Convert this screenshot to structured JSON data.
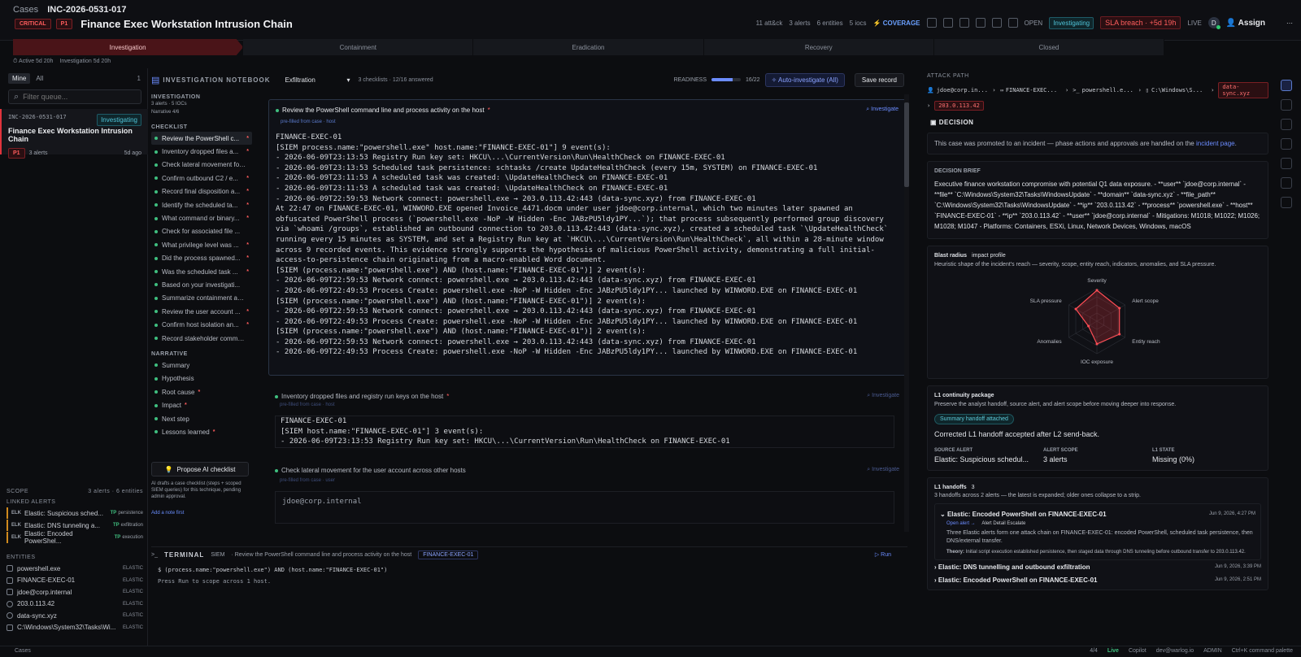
{
  "header": {
    "crumb_root": "Cases",
    "case_id": "INC-2026-0531-017",
    "severity_label": "CRITICAL",
    "priority": "P1",
    "title": "Finance Exec Workstation Intrusion Chain",
    "meta_attck": "11 att&ck",
    "meta_alerts": "3 alerts",
    "meta_entities": "6 entities",
    "meta_iocs": "5 iocs",
    "coverage_label": "COVERAGE",
    "open_label": "OPEN",
    "status": "Investigating",
    "sla": "SLA breach · +5d 19h",
    "live_label": "LIVE",
    "avatar_initial": "D",
    "assign_label": "Assign"
  },
  "phases": [
    "Investigation",
    "Containment",
    "Eradication",
    "Recovery",
    "Closed"
  ],
  "substatus": {
    "active": "Active 5d 20h",
    "investigation": "Investigation 5d 20h"
  },
  "queue": {
    "tab_mine": "Mine",
    "tab_all": "All",
    "count": "1",
    "filter_placeholder": "Filter queue...",
    "card": {
      "id": "INC-2026-0531-017",
      "status": "Investigating",
      "title": "Finance Exec Workstation Intrusion Chain",
      "priority": "P1",
      "alerts": "3 alerts",
      "ago": "5d ago"
    }
  },
  "scope": {
    "label": "SCOPE",
    "summary": "3 alerts · 6 entities",
    "linked_label": "LINKED ALERTS",
    "alerts": [
      {
        "src": "ELK",
        "name": "Elastic: Suspicious sched...",
        "tp": "TP",
        "tactic": "persistence"
      },
      {
        "src": "ELK",
        "name": "Elastic: DNS tunneling a...",
        "tp": "TP",
        "tactic": "exfiltration"
      },
      {
        "src": "ELK",
        "name": "Elastic: Encoded PowerShel...",
        "tp": "TP",
        "tactic": "execution"
      }
    ],
    "entities_label": "ENTITIES",
    "entities": [
      {
        "name": "powershell.exe",
        "src": "ELASTIC"
      },
      {
        "name": "FINANCE-EXEC-01",
        "src": "ELASTIC"
      },
      {
        "name": "jdoe@corp.internal",
        "src": "ELASTIC"
      },
      {
        "name": "203.0.113.42",
        "src": "ELASTIC"
      },
      {
        "name": "data-sync.xyz",
        "src": "ELASTIC"
      },
      {
        "name": "C:\\Windows\\System32\\Tasks\\Wi...",
        "src": "ELASTIC"
      }
    ]
  },
  "notebook": {
    "title": "INVESTIGATION NOTEBOOK",
    "technique": "Exfiltration",
    "sub": "3 checklists · 12/16 answered",
    "readiness_label": "READINESS",
    "readiness_value": "16/22",
    "readiness_fraction": 0.727,
    "auto_label": "Auto-investigate (All)",
    "save_label": "Save record",
    "inv_label": "INVESTIGATION",
    "inv_line1": "3 alerts · 5 IOCs",
    "inv_line2": "Narrative 4/6",
    "checklist_label": "CHECKLIST",
    "checklist": [
      "Review the PowerShell c...",
      "Inventory dropped files a...",
      "Check lateral movement for...",
      "Confirm outbound C2 / e...",
      "Record final disposition a...",
      "Identify the scheduled ta...",
      "What command or binary...",
      "Check for associated file ...",
      "What privilege level was ...",
      "Did the process spawned...",
      "Was the scheduled task ...",
      "Based on your investigati...",
      "Summarize containment an...",
      "Review the user account ...",
      "Confirm host isolation an...",
      "Record stakeholder commu..."
    ],
    "checklist_required": [
      true,
      true,
      false,
      true,
      true,
      true,
      true,
      false,
      true,
      true,
      true,
      false,
      false,
      true,
      true,
      false
    ],
    "narrative_label": "NARRATIVE",
    "narrative": [
      "Summary",
      "Hypothesis",
      "Root cause",
      "Impact",
      "Next step",
      "Lessons learned"
    ],
    "narrative_required": [
      false,
      false,
      true,
      true,
      false,
      true
    ],
    "propose_label": "Propose AI checklist",
    "propose_desc": "AI drafts a case checklist (steps + scoped SIEM queries) for this technique, pending admin approval.",
    "add_note": "Add a note first"
  },
  "tasks": [
    {
      "question": "Review the PowerShell command line and process activity on the host",
      "investigate": "Investigate",
      "prefill": "pre-filled from case · host",
      "body": "FINANCE-EXEC-01\n[SIEM process.name:\"powershell.exe\" host.name:\"FINANCE-EXEC-01\"] 9 event(s):\n- 2026-06-09T23:13:53 Registry Run key set: HKCU\\...\\CurrentVersion\\Run\\HealthCheck on FINANCE-EXEC-01\n- 2026-06-09T23:13:53 Scheduled task persistence: schtasks /create UpdateHealthCheck (every 15m, SYSTEM) on FINANCE-EXEC-01\n- 2026-06-09T23:11:53 A scheduled task was created: \\UpdateHealthCheck on FINANCE-EXEC-01\n- 2026-06-09T23:11:53 A scheduled task was created: \\UpdateHealthCheck on FINANCE-EXEC-01\n- 2026-06-09T22:59:53 Network connect: powershell.exe → 203.0.113.42:443 (data-sync.xyz) from FINANCE-EXEC-01\nAt 22:47 on FINANCE-EXEC-01, WINWORD.EXE opened Invoice_4471.docm under user jdoe@corp.internal, which two minutes later spawned an\nobfuscated PowerShell process (`powershell.exe -NoP -W Hidden -Enc JABzPU5ldy1PY...`); that process subsequently performed group discovery\nvia `whoami /groups`, established an outbound connection to 203.0.113.42:443 (data-sync.xyz), created a scheduled task `\\UpdateHealthCheck`\nrunning every 15 minutes as SYSTEM, and set a Registry Run key at `HKCU\\...\\CurrentVersion\\Run\\HealthCheck`, all within a 28-minute window\nacross 9 recorded events. This evidence strongly supports the hypothesis of malicious PowerShell activity, demonstrating a full initial-\naccess-to-persistence chain originating from a macro-enabled Word document.\n[SIEM (process.name:\"powershell.exe\") AND (host.name:\"FINANCE-EXEC-01\")] 2 event(s):\n- 2026-06-09T22:59:53 Network connect: powershell.exe → 203.0.113.42:443 (data-sync.xyz) from FINANCE-EXEC-01\n- 2026-06-09T22:49:53 Process Create: powershell.exe -NoP -W Hidden -Enc JABzPU5ldy1PY... launched by WINWORD.EXE on FINANCE-EXEC-01\n[SIEM (process.name:\"powershell.exe\") AND (host.name:\"FINANCE-EXEC-01\")] 2 event(s):\n- 2026-06-09T22:59:53 Network connect: powershell.exe → 203.0.113.42:443 (data-sync.xyz) from FINANCE-EXEC-01\n- 2026-06-09T22:49:53 Process Create: powershell.exe -NoP -W Hidden -Enc JABzPU5ldy1PY... launched by WINWORD.EXE on FINANCE-EXEC-01\n[SIEM (process.name:\"powershell.exe\") AND (host.name:\"FINANCE-EXEC-01\")] 2 event(s):\n- 2026-06-09T22:59:53 Network connect: powershell.exe → 203.0.113.42:443 (data-sync.xyz) from FINANCE-EXEC-01\n- 2026-06-09T22:49:53 Process Create: powershell.exe -NoP -W Hidden -Enc JABzPU5ldy1PY... launched by WINWORD.EXE on FINANCE-EXEC-01"
    },
    {
      "question": "Inventory dropped files and registry run keys on the host",
      "investigate": "Investigate",
      "prefill": "pre-filled from case · host",
      "body": "FINANCE-EXEC-01\n[SIEM host.name:\"FINANCE-EXEC-01\"] 3 event(s):\n- 2026-06-09T23:13:53 Registry Run key set: HKCU\\...\\CurrentVersion\\Run\\HealthCheck on FINANCE-EXEC-01"
    },
    {
      "question": "Check lateral movement for the user account across other hosts",
      "investigate": "Investigate",
      "prefill": "pre-filled from case · user",
      "body": "jdoe@corp.internal"
    }
  ],
  "terminal": {
    "label": "TERMINAL",
    "mode": "SIEM",
    "context": "· Review the PowerShell command line and process activity on the host",
    "host": "FINANCE-EXEC-01",
    "run_label": "Run",
    "query": "$ (process.name:\"powershell.exe\") AND (host.name:\"FINANCE-EXEC-01\")",
    "hint": "Press Run to scope across 1 host."
  },
  "right": {
    "attack_path_label": "ATTACK PATH",
    "chain": [
      "jdoe@corp.in...",
      "FINANCE-EXEC...",
      "powershell.e...",
      "C:\\Windows\\S...",
      "data-sync.xyz",
      "203.0.113.42"
    ],
    "decision_label": "DECISION",
    "decision_note": "This case was promoted to an incident — phase actions and approvals are handled on the",
    "decision_link": "incident page",
    "brief_label": "DECISION BRIEF",
    "brief": "Executive finance workstation compromise with potential Q1 data exposure. - **user** `jdoe@corp.internal` - **file** `C:\\Windows\\System32\\Tasks\\WindowsUpdate` - **domain** `data-sync.xyz` - **file_path** `C:\\Windows\\System32\\Tasks\\WindowsUpdate` - **ip** `203.0.113.42` - **process** `powershell.exe` - **host** `FINANCE-EXEC-01` - **ip** `203.0.113.42` - **user** `jdoe@corp.internal` - Mitigations: M1018; M1022; M1026; M1028; M1047 - Platforms: Containers, ESXi, Linux, Network Devices, Windows, macOS",
    "blast_label": "Blast radius",
    "blast_sub": "impact profile",
    "blast_desc": "Heuristic shape of the incident's reach — severity, scope, entity reach, indicators, anomalies, and SLA pressure.",
    "l1_label": "L1 continuity package",
    "l1_desc": "Preserve the analyst handoff, source alert, and alert scope before moving deeper into response.",
    "l1_badge": "Summary handoff attached",
    "l1_status": "Corrected L1 handoff accepted after L2 send-back.",
    "source_alert_label": "SOURCE ALERT",
    "source_alert": "Elastic: Suspicious schedul...",
    "alert_scope_label": "ALERT SCOPE",
    "alert_scope": "3 alerts",
    "l1_state_label": "L1 STATE",
    "l1_state": "Missing (0%)",
    "handoffs_label": "L1 handoffs",
    "handoffs_count": "3",
    "handoffs_desc": "3 handoffs across 2 alerts — the latest is expanded; older ones collapse to a strip.",
    "handoffs": [
      {
        "title": "Elastic: Encoded PowerShell on FINANCE-EXEC-01",
        "date": "Jun 9, 2026, 4:27 PM"
      },
      {
        "title": "Elastic: DNS tunnelling and outbound exfiltration",
        "date": "Jun 9, 2026, 3:39 PM"
      },
      {
        "title": "Elastic: Encoded PowerShell on FINANCE-EXEC-01",
        "date": "Jun 9, 2026, 2:51 PM"
      }
    ],
    "ho_open": "Open alert →",
    "ho_tag": "Alert Detail Escalate",
    "ho_body": "Three Elastic alerts form one attack chain on FINANCE-EXEC-01: encoded PowerShell, scheduled task persistence, then DNS/external transfer.",
    "ho_theory_label": "Theory:",
    "ho_theory": "Initial script execution established persistence, then staged data through DNS tunneling before outbound transfer to 203.0.113.42."
  },
  "chart_data": {
    "type": "radar",
    "title": "",
    "axes": [
      "Severity",
      "Alert scope",
      "Entity reach",
      "IOC exposure",
      "Anomalies",
      "SLA pressure"
    ],
    "values": [
      0.95,
      0.8,
      0.8,
      0.7,
      0.3,
      0.75
    ],
    "range": [
      0,
      1
    ]
  },
  "status": {
    "left": "Cases",
    "checks": "4/4",
    "live": "Live",
    "copilot": "Copilot",
    "user": "dev@warlog.io",
    "role": "ADMIN",
    "palette": "Ctrl+K command palette"
  },
  "colors": {
    "accent": "#6b8cff",
    "critical": "#e0343c",
    "ok": "#3fbf7f"
  }
}
